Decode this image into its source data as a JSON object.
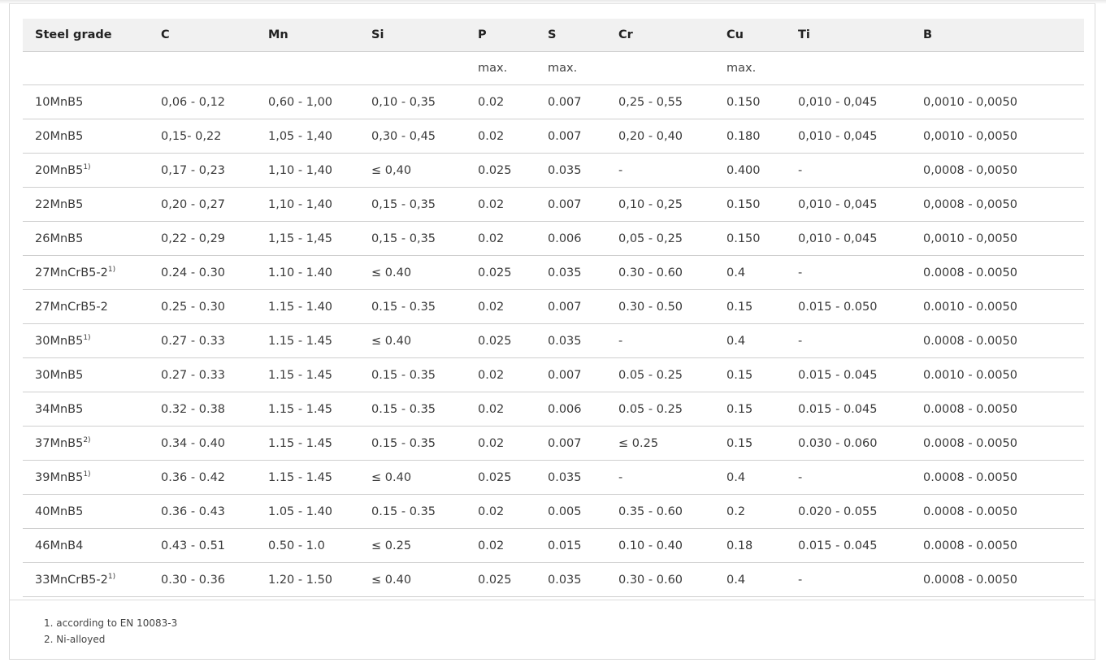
{
  "headers": [
    "Steel grade",
    "C",
    "Mn",
    "Si",
    "P",
    "S",
    "Cr",
    "Cu",
    "Ti",
    "B"
  ],
  "units": [
    "",
    "",
    "",
    "",
    "max.",
    "max.",
    "",
    "max.",
    "",
    ""
  ],
  "rows": [
    {
      "grade": "10MnB5",
      "note": "",
      "cells": [
        "0,06 - 0,12",
        "0,60 - 1,00",
        "0,10 - 0,35",
        "0.02",
        "0.007",
        "0,25 - 0,55",
        "0.150",
        "0,010 - 0,045",
        "0,0010 - 0,0050"
      ]
    },
    {
      "grade": "20MnB5",
      "note": "",
      "cells": [
        "0,15- 0,22",
        "1,05 - 1,40",
        "0,30 - 0,45",
        "0.02",
        "0.007",
        "0,20 - 0,40",
        "0.180",
        "0,010 - 0,045",
        "0,0010 - 0,0050"
      ]
    },
    {
      "grade": "20MnB5",
      "note": "1)",
      "cells": [
        "0,17 - 0,23",
        "1,10 - 1,40",
        "≤ 0,40",
        "0.025",
        "0.035",
        "-",
        "0.400",
        "-",
        "0,0008 - 0,0050"
      ]
    },
    {
      "grade": "22MnB5",
      "note": "",
      "cells": [
        "0,20 - 0,27",
        "1,10 - 1,40",
        "0,15 - 0,35",
        "0.02",
        "0.007",
        "0,10 - 0,25",
        "0.150",
        "0,010 - 0,045",
        "0,0008 - 0,0050"
      ]
    },
    {
      "grade": "26MnB5",
      "note": "",
      "cells": [
        "0,22 - 0,29",
        "1,15 - 1,45",
        "0,15 - 0,35",
        "0.02",
        "0.006",
        "0,05 - 0,25",
        "0.150",
        "0,010 - 0,045",
        "0,0010 - 0,0050"
      ]
    },
    {
      "grade": "27MnCrB5-2",
      "note": "1)",
      "cells": [
        "0.24 - 0.30",
        "1.10 - 1.40",
        "≤ 0.40",
        "0.025",
        "0.035",
        "0.30 - 0.60",
        "0.4",
        "-",
        "0.0008 - 0.0050"
      ]
    },
    {
      "grade": "27MnCrB5-2",
      "note": "",
      "cells": [
        "0.25 - 0.30",
        "1.15 - 1.40",
        "0.15 - 0.35",
        "0.02",
        "0.007",
        "0.30 - 0.50",
        "0.15",
        "0.015 - 0.050",
        "0.0010 - 0.0050"
      ]
    },
    {
      "grade": "30MnB5",
      "note": "1)",
      "cells": [
        "0.27 - 0.33",
        "1.15 - 1.45",
        "≤ 0.40",
        "0.025",
        "0.035",
        "-",
        "0.4",
        "-",
        "0.0008 - 0.0050"
      ]
    },
    {
      "grade": "30MnB5",
      "note": "",
      "cells": [
        "0.27 - 0.33",
        "1.15 - 1.45",
        "0.15 - 0.35",
        "0.02",
        "0.007",
        "0.05 - 0.25",
        "0.15",
        "0.015 - 0.045",
        "0.0010 - 0.0050"
      ]
    },
    {
      "grade": "34MnB5",
      "note": "",
      "cells": [
        "0.32 - 0.38",
        "1.15 - 1.45",
        "0.15 - 0.35",
        "0.02",
        "0.006",
        "0.05 - 0.25",
        "0.15",
        "0.015 - 0.045",
        "0.0008 - 0.0050"
      ]
    },
    {
      "grade": "37MnB5",
      "note": "2)",
      "cells": [
        "0.34 - 0.40",
        "1.15 - 1.45",
        "0.15 - 0.35",
        "0.02",
        "0.007",
        "≤ 0.25",
        "0.15",
        "0.030 - 0.060",
        "0.0008 - 0.0050"
      ]
    },
    {
      "grade": "39MnB5",
      "note": "1)",
      "cells": [
        "0.36 - 0.42",
        "1.15 - 1.45",
        "≤ 0.40",
        "0.025",
        "0.035",
        "-",
        "0.4",
        "-",
        "0.0008 - 0.0050"
      ]
    },
    {
      "grade": "40MnB5",
      "note": "",
      "cells": [
        "0.36 - 0.43",
        "1.05 - 1.40",
        "0.15 - 0.35",
        "0.02",
        "0.005",
        "0.35 - 0.60",
        "0.2",
        "0.020 - 0.055",
        "0.0008 - 0.0050"
      ]
    },
    {
      "grade": "46MnB4",
      "note": "",
      "cells": [
        "0.43 - 0.51",
        "0.50 - 1.0",
        "≤ 0.25",
        "0.02",
        "0.015",
        "0.10 - 0.40",
        "0.18",
        "0.015 - 0.045",
        "0.0008 - 0.0050"
      ]
    },
    {
      "grade": "33MnCrB5-2",
      "note": "1)",
      "cells": [
        "0.30 - 0.36",
        "1.20 - 1.50",
        "≤ 0.40",
        "0.025",
        "0.035",
        "0.30 - 0.60",
        "0.4",
        "-",
        "0.0008 - 0.0050"
      ]
    }
  ],
  "footnotes": [
    "1. according to  EN 10083-3",
    "2. Ni-alloyed"
  ]
}
